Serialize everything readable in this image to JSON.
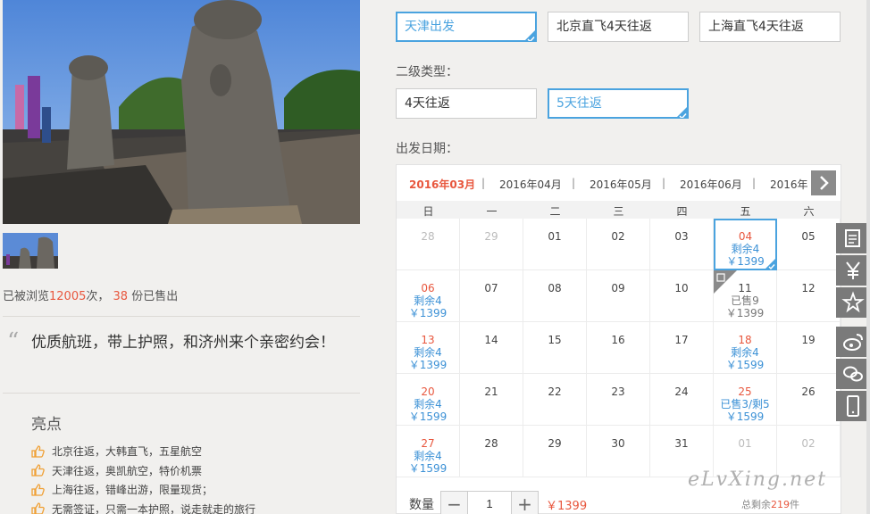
{
  "stats": {
    "prefix": "已被浏览",
    "views": "12005",
    "mid": "次，",
    "sold": "38",
    "suffix": "份已售出"
  },
  "slogan": "优质航班，带上护照，和济州来个亲密约会！",
  "highlights": {
    "title": "亮点",
    "items": [
      "北京往返，大韩直飞，五星航空",
      "天津往返，奥凯航空，特价机票",
      "上海往返，错峰出游，限量现货；",
      "无需签证，只需一本护照，说走就走的旅行"
    ]
  },
  "departure": {
    "options": [
      "天津出发",
      "北京直飞4天往返",
      "上海直飞4天往返"
    ],
    "selected": 0
  },
  "secondary_type": {
    "label": "二级类型：",
    "options": [
      "4天往返",
      "5天往返"
    ],
    "selected": 1
  },
  "date_label": "出发日期：",
  "calendar": {
    "months": [
      "2016年03月",
      "2016年04月",
      "2016年05月",
      "2016年06月",
      "2016年"
    ],
    "weekdays": [
      "日",
      "一",
      "二",
      "三",
      "四",
      "五",
      "六"
    ],
    "rows": [
      [
        {
          "d": "28",
          "g": true
        },
        {
          "d": "29",
          "g": true
        },
        {
          "d": "01"
        },
        {
          "d": "02"
        },
        {
          "d": "03"
        },
        {
          "d": "04",
          "red": true,
          "rem": "剩余4",
          "price": "￥1399",
          "selected": true
        },
        {
          "d": "05"
        }
      ],
      [
        {
          "d": "06",
          "red": true,
          "rem": "剩余4",
          "price": "￥1399"
        },
        {
          "d": "07"
        },
        {
          "d": "08"
        },
        {
          "d": "09"
        },
        {
          "d": "10"
        },
        {
          "d": "11",
          "sold": "已售9",
          "price": "￥1399",
          "tag": true
        },
        {
          "d": "12"
        }
      ],
      [
        {
          "d": "13",
          "red": true,
          "rem": "剩余4",
          "price": "￥1399"
        },
        {
          "d": "14"
        },
        {
          "d": "15"
        },
        {
          "d": "16"
        },
        {
          "d": "17"
        },
        {
          "d": "18",
          "red": true,
          "rem": "剩余4",
          "price": "￥1599"
        },
        {
          "d": "19"
        }
      ],
      [
        {
          "d": "20",
          "red": true,
          "rem": "剩余4",
          "price": "￥1599"
        },
        {
          "d": "21"
        },
        {
          "d": "22"
        },
        {
          "d": "23"
        },
        {
          "d": "24"
        },
        {
          "d": "25",
          "red": true,
          "rem": "已售3/剩5",
          "price": "￥1599"
        },
        {
          "d": "26"
        }
      ],
      [
        {
          "d": "27",
          "red": true,
          "rem": "剩余4",
          "price": "￥1599"
        },
        {
          "d": "28"
        },
        {
          "d": "29"
        },
        {
          "d": "30"
        },
        {
          "d": "31"
        },
        {
          "d": "01",
          "g": true
        },
        {
          "d": "02",
          "g": true
        }
      ]
    ]
  },
  "quantity": {
    "label": "数量",
    "minus": "−",
    "plus": "+",
    "value": "1",
    "price": "￥1399"
  },
  "total": {
    "prefix": "总剩余",
    "count": "219",
    "suffix": "件"
  },
  "watermark": "eLvXing.net",
  "sidebar_icons": [
    "clipboard-icon",
    "yen-icon",
    "star-icon",
    "weibo-icon",
    "wechat-icon",
    "mobile-icon"
  ],
  "colors": {
    "accent": "#4aa3df",
    "red": "#e8573e",
    "sidebar": "#7a7a7a"
  }
}
